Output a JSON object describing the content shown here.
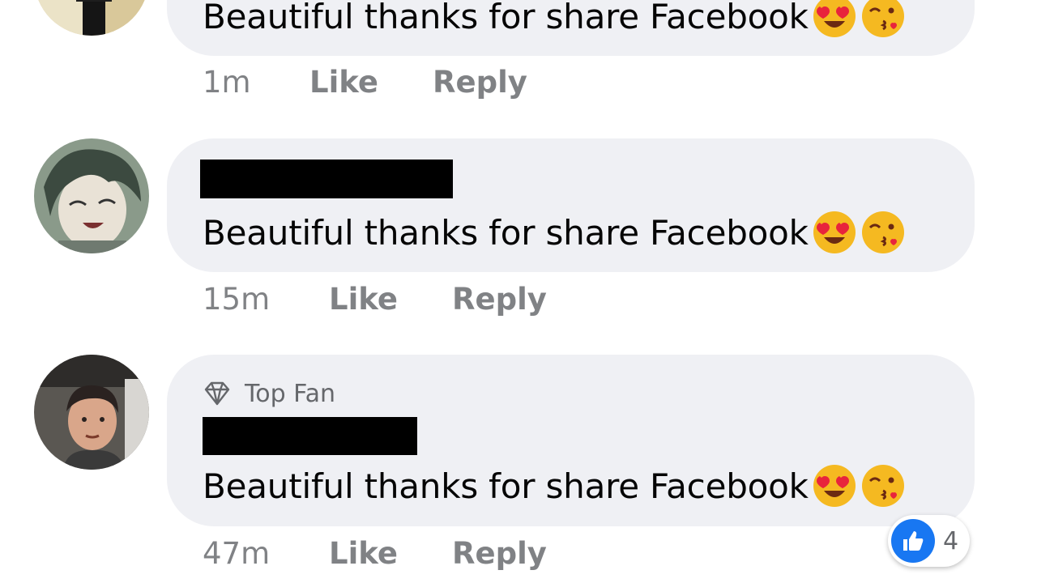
{
  "comments": [
    {
      "text": "Beautiful thanks for share Facebook",
      "emojis": [
        "heart-eyes-emoji",
        "kissing-wink-emoji"
      ],
      "time": "1m",
      "like_label": "Like",
      "reply_label": "Reply"
    },
    {
      "text": "Beautiful thanks for share Facebook",
      "emojis": [
        "heart-eyes-emoji",
        "kissing-wink-emoji"
      ],
      "time": "15m",
      "like_label": "Like",
      "reply_label": "Reply"
    },
    {
      "badge": "Top Fan",
      "text": "Beautiful thanks for share Facebook",
      "emojis": [
        "heart-eyes-emoji",
        "kissing-wink-emoji"
      ],
      "time": "47m",
      "like_label": "Like",
      "reply_label": "Reply",
      "reaction_count": "4"
    }
  ],
  "colors": {
    "bubble": "#eff0f4",
    "meta_text": "#65676b",
    "like_blue": "#1877f2"
  }
}
